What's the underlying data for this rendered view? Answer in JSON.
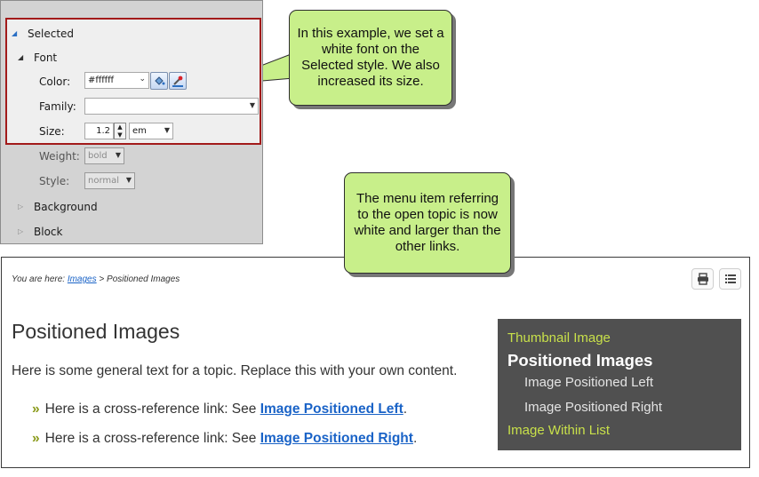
{
  "panel": {
    "selected_label": "Selected",
    "font_label": "Font",
    "color_label": "Color:",
    "color_value": "#ffffff",
    "family_label": "Family:",
    "family_value": "",
    "size_label": "Size:",
    "size_value": "1.2",
    "size_unit": "em",
    "weight_label": "Weight:",
    "weight_value": "bold",
    "style_label": "Style:",
    "style_value": "normal",
    "background_label": "Background",
    "block_label": "Block"
  },
  "callouts": {
    "top": "In this example, we set a white font on the Selected style. We also increased its size.",
    "menu": "The menu item referring to the open topic is now white and larger than the other links."
  },
  "page": {
    "breadcrumb_prefix": "You are here:",
    "breadcrumb_link": "Images",
    "breadcrumb_sep": ">",
    "breadcrumb_current": "Positioned Images",
    "title": "Positioned Images",
    "intro": "Here is some general text for a topic. Replace this with your own content.",
    "xrefs": [
      {
        "text": "Here is a cross-reference link: See",
        "link": "Image Positioned Left",
        "end": "."
      },
      {
        "text": "Here is a cross-reference link: See",
        "link": "Image Positioned Right",
        "end": "."
      }
    ]
  },
  "menu": {
    "items": [
      {
        "label": "Thumbnail Image"
      },
      {
        "label": "Positioned Images"
      },
      {
        "label": "Image Positioned Left"
      },
      {
        "label": "Image Positioned Right"
      },
      {
        "label": "Image Within List"
      }
    ]
  },
  "colors": {
    "callout_fill": "#c8ef8a",
    "menu_bg": "#505050",
    "menu_link": "#c8e04a",
    "menu_selected": "#ffffff",
    "highlight_border": "#a21a1a"
  },
  "icons": [
    "expand-triangle-icon",
    "collapse-triangle-icon",
    "paint-bucket-icon",
    "eyedropper-icon",
    "print-icon",
    "list-icon"
  ]
}
